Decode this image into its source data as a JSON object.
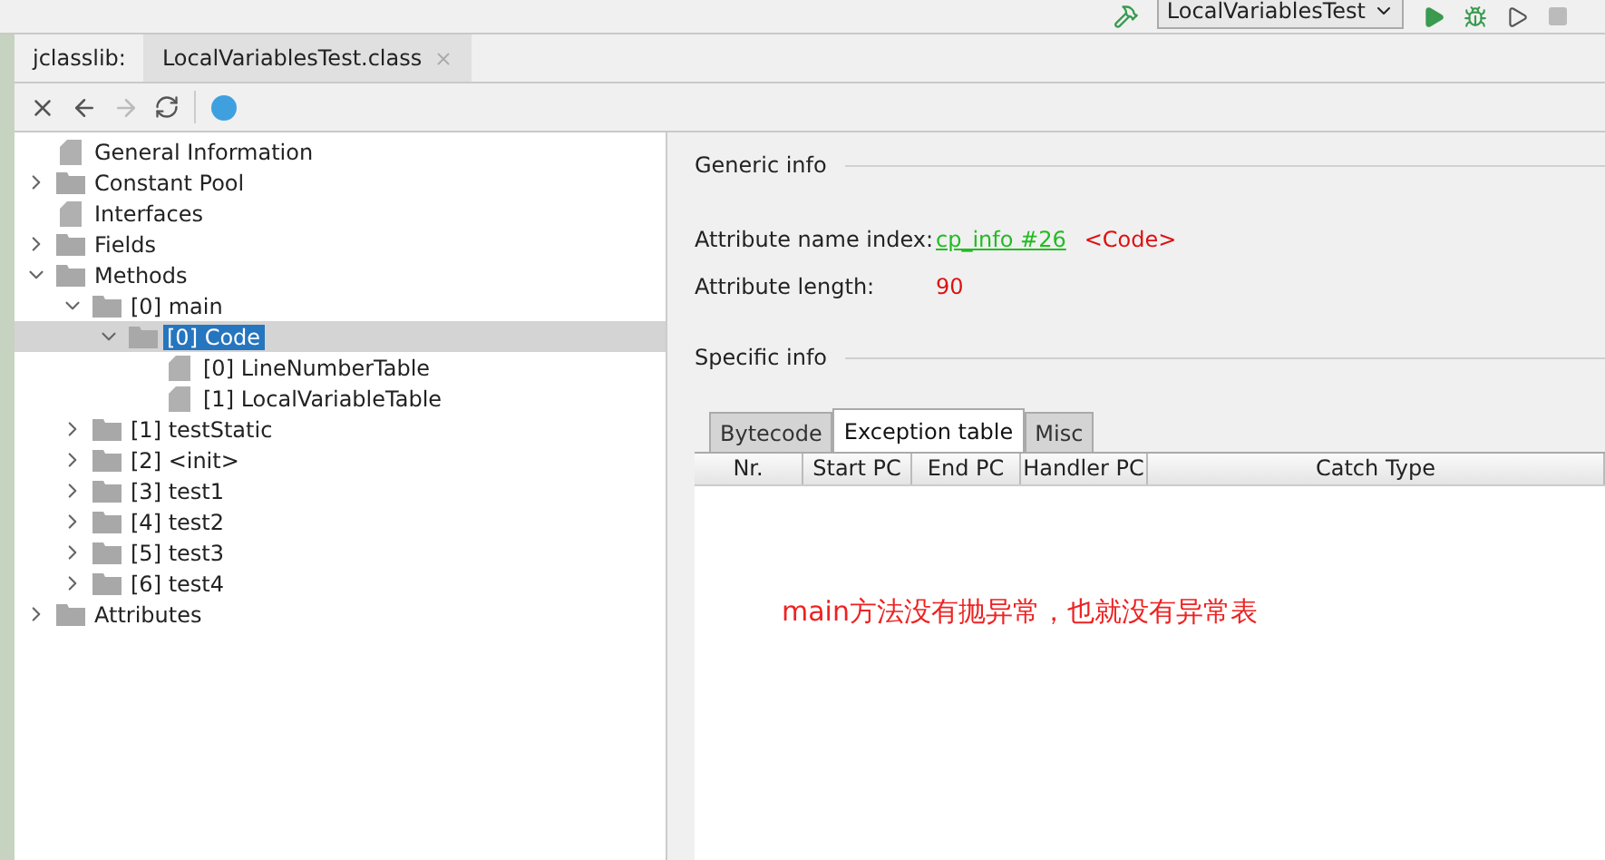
{
  "run_toolbar": {
    "configuration": "LocalVariablesTest"
  },
  "editor_tabs": [
    {
      "label": "jclasslib:",
      "kind": "caption",
      "selected": false
    },
    {
      "label": "LocalVariablesTest.class",
      "kind": "tab",
      "selected": true
    }
  ],
  "tree": [
    {
      "label": "General Information",
      "kind": "file",
      "selected": false
    },
    {
      "label": "Constant Pool",
      "kind": "folder",
      "expanded": false,
      "selected": false
    },
    {
      "label": "Interfaces",
      "kind": "file",
      "selected": false
    },
    {
      "label": "Fields",
      "kind": "folder",
      "expanded": false,
      "selected": false
    },
    {
      "label": "Methods",
      "kind": "folder",
      "expanded": true,
      "selected": false,
      "children": [
        {
          "label": "[0] main",
          "kind": "folder",
          "expanded": true,
          "selected": false,
          "children": [
            {
              "label": "[0] Code",
              "kind": "folder",
              "expanded": true,
              "selected": true,
              "children": [
                {
                  "label": "[0] LineNumberTable",
                  "kind": "file",
                  "selected": false
                },
                {
                  "label": "[1] LocalVariableTable",
                  "kind": "file",
                  "selected": false
                }
              ]
            }
          ]
        },
        {
          "label": "[1] testStatic",
          "kind": "folder",
          "expanded": false,
          "selected": false
        },
        {
          "label": "[2] <init>",
          "kind": "folder",
          "expanded": false,
          "selected": false
        },
        {
          "label": "[3] test1",
          "kind": "folder",
          "expanded": false,
          "selected": false
        },
        {
          "label": "[4] test2",
          "kind": "folder",
          "expanded": false,
          "selected": false
        },
        {
          "label": "[5] test3",
          "kind": "folder",
          "expanded": false,
          "selected": false
        },
        {
          "label": "[6] test4",
          "kind": "folder",
          "expanded": false,
          "selected": false
        }
      ]
    },
    {
      "label": "Attributes",
      "kind": "folder",
      "expanded": false,
      "selected": false
    }
  ],
  "generic_info": {
    "title": "Generic info",
    "fields": [
      {
        "label": "Attribute name index:",
        "link": "cp_info #26",
        "value": "<Code>"
      },
      {
        "label": "Attribute length:",
        "value": "90"
      }
    ]
  },
  "specific_info": {
    "title": "Specific info",
    "tabs": [
      {
        "label": "Bytecode",
        "selected": false
      },
      {
        "label": "Exception table",
        "selected": true
      },
      {
        "label": "Misc",
        "selected": false
      }
    ],
    "columns": [
      "Nr.",
      "Start PC",
      "End PC",
      "Handler PC",
      "Catch Type"
    ]
  },
  "annotation": "main方法没有抛异常，也就没有异常表"
}
